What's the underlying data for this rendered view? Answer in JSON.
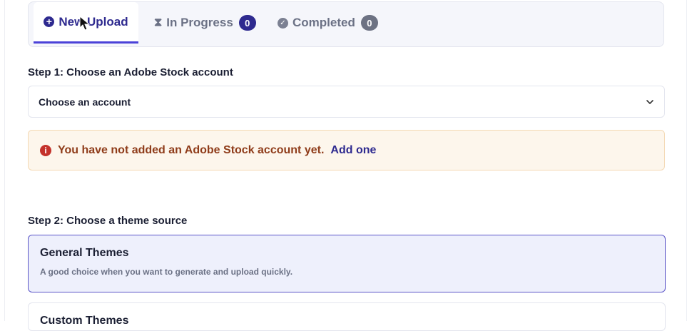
{
  "tabs": {
    "new_upload": "New Upload",
    "in_progress": "In Progress",
    "in_progress_count": "0",
    "completed": "Completed",
    "completed_count": "0"
  },
  "step1": {
    "label": "Step 1: Choose an Adobe Stock account",
    "select_value": "Choose an account"
  },
  "alert": {
    "message": "You have not added an Adobe Stock account yet.",
    "link": "Add one"
  },
  "step2": {
    "label": "Step 2: Choose a theme source",
    "options": [
      {
        "title": "General Themes",
        "description": "A good choice when you want to generate and upload quickly."
      },
      {
        "title": "Custom Themes"
      }
    ]
  },
  "icons": {
    "new_upload": "plus-circle-icon",
    "in_progress": "hourglass-icon",
    "completed": "check-circle-icon",
    "select": "chevron-down-icon",
    "alert": "info-icon"
  },
  "colors": {
    "accent": "#4b42d8",
    "accent_dark": "#2e2a8f",
    "alert_bg": "#fdf6ec",
    "alert_text": "#8f3c1a",
    "selected_card_bg": "#eef0fc"
  }
}
